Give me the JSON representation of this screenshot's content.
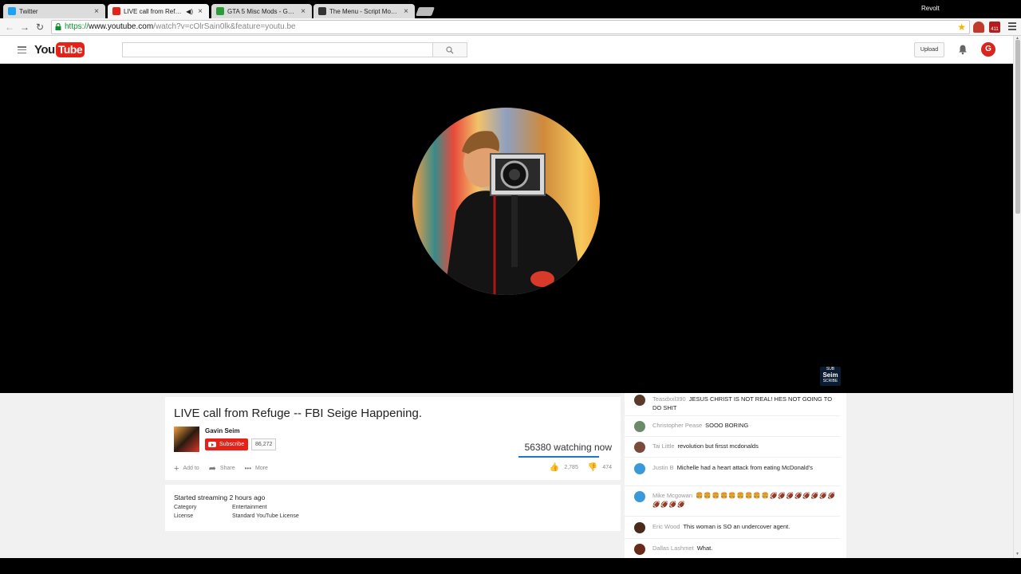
{
  "browser": {
    "tabs": [
      {
        "title": "Twitter",
        "favicon_color": "#1da1f2"
      },
      {
        "title": "LIVE call from Refuge -",
        "favicon_color": "#e62117"
      },
      {
        "title": "GTA 5 Misc Mods - GTA5-",
        "favicon_color": "#2a9d3a"
      },
      {
        "title": "The Menu - Script Modific",
        "favicon_color": "#333333"
      }
    ],
    "tab_close": "×",
    "profile_name": "Revolt",
    "url_scheme": "https://",
    "url_host": "www.youtube.com",
    "url_rest": "/watch?v=cOlrSain0lk&feature=youtu.be",
    "back": "←",
    "forward": "→",
    "reload": "↻",
    "star": "★",
    "ext_badge": "411"
  },
  "youtube": {
    "logo_you": "You",
    "logo_tube": "Tube",
    "search_placeholder": "",
    "upload_label": "Upload",
    "user_initial": "G"
  },
  "player": {
    "badge_top": "SUB",
    "badge_name": "Seim",
    "badge_bottom": "SCRIBE"
  },
  "video": {
    "title": "LIVE call from Refuge -- FBI Seige Happening.",
    "channel": "Gavin Seim",
    "subscribe_label": "Subscribe",
    "subscriber_count": "86,272",
    "watching": "56380 watching now",
    "actions": [
      {
        "icon": "+",
        "label": "Add to"
      },
      {
        "icon": "➦",
        "label": "Share"
      },
      {
        "icon": "•••",
        "label": "More"
      }
    ],
    "likes": "2,785",
    "dislikes": "474"
  },
  "description": {
    "started": "Started streaming 2 hours ago",
    "rows": [
      {
        "key": "Category",
        "value": "Entertainment"
      },
      {
        "key": "License",
        "value": "Standard YouTube License"
      }
    ]
  },
  "chat": [
    {
      "author": "Teasdxxl390",
      "text": "JESUS CHRIST IS NOT REAL! HES NOT GOING TO DO SHIT",
      "avatar": "#5a3a2a"
    },
    {
      "author": "Christopher Pease",
      "text": "SOOO BORING",
      "avatar": "#6a8a6a"
    },
    {
      "author": "Tai Little",
      "text": "revolution but firsst mcdonalds",
      "avatar": "#7a4a3a"
    },
    {
      "author": "Justin B",
      "text": "Michelle had a heart attack from eating McDonald's",
      "avatar": "#3a9ad9"
    },
    {
      "author": "Mike Mcgowan",
      "text": "",
      "emoji": "🍔🍔🍔🍔🍔🍔🍔🍔🍔🏈🏈🏈🏈🏈🏈🏈🏈🏈🏈🏈🏈",
      "avatar": "#3a9ad9"
    },
    {
      "author": "Eric Wood",
      "text": "This woman is SO an undercover agent.",
      "avatar": "#4a2a1a"
    },
    {
      "author": "Dallas Lashmet",
      "text": "What.",
      "avatar": "#6a2a1a"
    }
  ]
}
